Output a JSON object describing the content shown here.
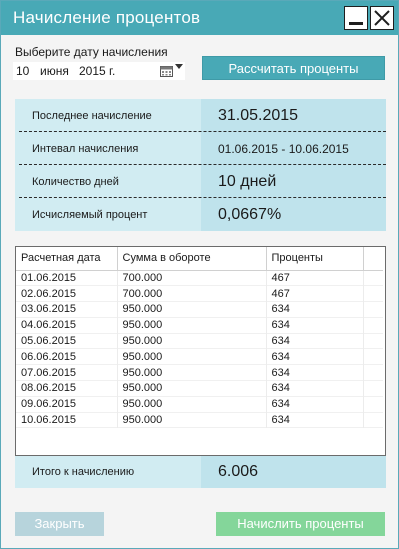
{
  "window": {
    "title": "Начисление процентов"
  },
  "date_picker": {
    "label": "Выберите дату начисления",
    "day": "10",
    "month": "июня",
    "year": "2015 г."
  },
  "buttons": {
    "calculate": "Рассчитать проценты",
    "close": "Закрыть",
    "accrue": "Начислить проценты"
  },
  "info": {
    "last_accrual_label": "Последнее начисление",
    "last_accrual_value": "31.05.2015",
    "interval_label": "Интевал начисления",
    "interval_value": "01.06.2015 - 10.06.2015",
    "days_label": "Количество дней",
    "days_value": "10 дней",
    "rate_label": "Исчисляемый процент",
    "rate_value": "0,0667%"
  },
  "table": {
    "headers": [
      "Расчетная дата",
      "Сумма в обороте",
      "Проценты"
    ],
    "rows": [
      [
        "01.06.2015",
        "700.000",
        "467"
      ],
      [
        "02.06.2015",
        "700.000",
        "467"
      ],
      [
        "03.06.2015",
        "950.000",
        "634"
      ],
      [
        "04.06.2015",
        "950.000",
        "634"
      ],
      [
        "05.06.2015",
        "950.000",
        "634"
      ],
      [
        "06.06.2015",
        "950.000",
        "634"
      ],
      [
        "07.06.2015",
        "950.000",
        "634"
      ],
      [
        "08.06.2015",
        "950.000",
        "634"
      ],
      [
        "09.06.2015",
        "950.000",
        "634"
      ],
      [
        "10.06.2015",
        "950.000",
        "634"
      ]
    ]
  },
  "total": {
    "label": "Итого к начислению",
    "value": "6.006"
  },
  "colors": {
    "accent": "#48a9b6",
    "info_label_bg": "#d1ecf2",
    "info_value_bg": "#bfe3ec",
    "accrue_button": "#84d69a",
    "close_button_disabled": "#b7d4dc"
  },
  "icons": [
    "minimize-icon",
    "close-icon",
    "calendar-icon",
    "dropdown-arrow-icon"
  ]
}
